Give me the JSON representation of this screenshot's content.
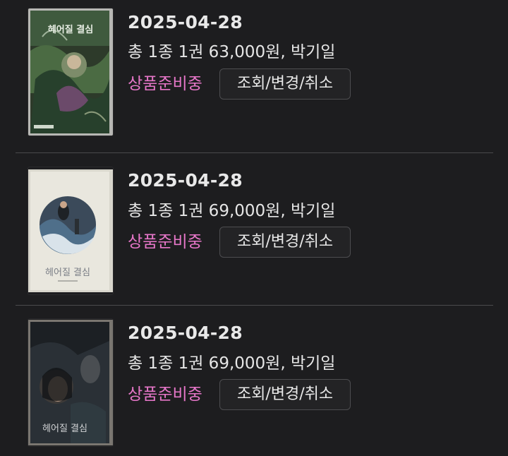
{
  "theme": {
    "background": "#1d1d1f",
    "status_color": "#e777c9",
    "text_color": "#e6e6e6"
  },
  "orders": [
    {
      "date": "2025-04-28",
      "summary": "총 1종 1권 63,000원, 박기일",
      "status": "상품준비중",
      "action_label": "조회/변경/취소",
      "cover_title": "헤어질 결심"
    },
    {
      "date": "2025-04-28",
      "summary": "총 1종 1권 69,000원, 박기일",
      "status": "상품준비중",
      "action_label": "조회/변경/취소",
      "cover_title": "헤어질 결심"
    },
    {
      "date": "2025-04-28",
      "summary": "총 1종 1권 69,000원, 박기일",
      "status": "상품준비중",
      "action_label": "조회/변경/취소",
      "cover_title": "헤어질 결심"
    }
  ]
}
